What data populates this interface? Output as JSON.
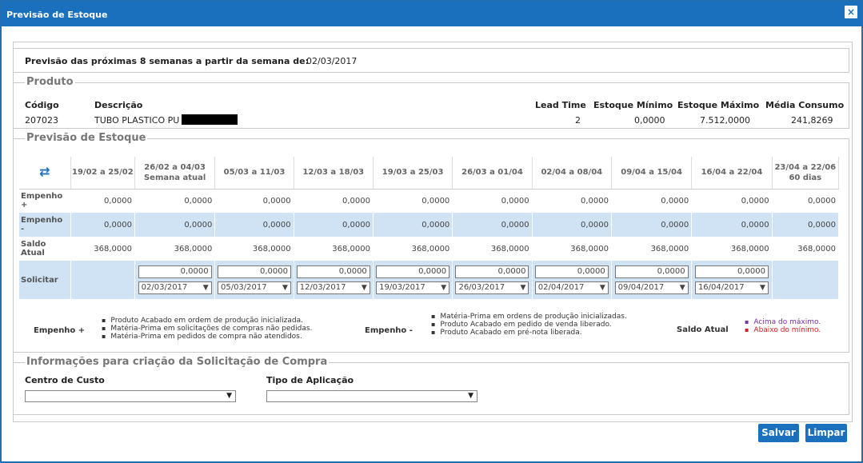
{
  "window": {
    "title": "Previsão de Estoque",
    "close_glyph": "×"
  },
  "week": {
    "label": "Previsão das próximas 8 semanas a partir da semana de:",
    "value": "02/03/2017"
  },
  "produto": {
    "legend": "Produto",
    "headers": {
      "codigo": "Código",
      "descricao": "Descrição",
      "lead_time": "Lead Time",
      "estoque_minimo": "Estoque Mínimo",
      "estoque_maximo": "Estoque Máximo",
      "media_consumo": "Média Consumo"
    },
    "values": {
      "codigo": "207023",
      "descricao": "TUBO PLASTICO PU C",
      "lead_time": "2",
      "estoque_minimo": "0,0000",
      "estoque_maximo": "7.512,0000",
      "media_consumo": "241,8269"
    }
  },
  "forecast": {
    "legend": "Previsão de Estoque",
    "refresh_icon": "refresh-icon",
    "columns": [
      {
        "range": "19/02 a 25/02",
        "sub": ""
      },
      {
        "range": "26/02 a 04/03",
        "sub": "Semana atual"
      },
      {
        "range": "05/03 a 11/03",
        "sub": ""
      },
      {
        "range": "12/03 a 18/03",
        "sub": ""
      },
      {
        "range": "19/03 a 25/03",
        "sub": ""
      },
      {
        "range": "26/03 a 01/04",
        "sub": ""
      },
      {
        "range": "02/04 a 08/04",
        "sub": ""
      },
      {
        "range": "09/04 a 15/04",
        "sub": ""
      },
      {
        "range": "16/04 a 22/04",
        "sub": ""
      },
      {
        "range": "23/04 a 22/06",
        "sub": "60 dias"
      }
    ],
    "rows": {
      "empenho_mais": {
        "label": "Empenho +",
        "values": [
          "0,0000",
          "0,0000",
          "0,0000",
          "0,0000",
          "0,0000",
          "0,0000",
          "0,0000",
          "0,0000",
          "0,0000",
          "0,0000"
        ]
      },
      "empenho_menos": {
        "label": "Empenho -",
        "values": [
          "0,0000",
          "0,0000",
          "0,0000",
          "0,0000",
          "0,0000",
          "0,0000",
          "0,0000",
          "0,0000",
          "0,0000",
          "0,0000"
        ]
      },
      "saldo_atual": {
        "label": "Saldo Atual",
        "values": [
          "368,0000",
          "368,0000",
          "368,0000",
          "368,0000",
          "368,0000",
          "368,0000",
          "368,0000",
          "368,0000",
          "368,0000",
          "368,0000"
        ]
      },
      "solicitar": {
        "label": "Solicitar",
        "quantities": [
          "0,0000",
          "0,0000",
          "0,0000",
          "0,0000",
          "0,0000",
          "0,0000",
          "0,0000",
          "0,0000"
        ],
        "dates": [
          "02/03/2017",
          "05/03/2017",
          "12/03/2017",
          "19/03/2017",
          "26/03/2017",
          "02/04/2017",
          "09/04/2017",
          "16/04/2017"
        ]
      }
    },
    "legend_notes": {
      "empenho_mais": {
        "title": "Empenho +",
        "items": [
          "Produto Acabado em ordem de produção inicializada.",
          "Matéria-Prima em solicitações de compras não pedidas.",
          "Matéria-Prima em pedidos de compra não atendidos."
        ]
      },
      "empenho_menos": {
        "title": "Empenho -",
        "items": [
          "Matéria-Prima em ordens de produção inicializadas.",
          "Produto Acabado em pedido de venda liberado.",
          "Produto Acabado em pré-nota liberada."
        ]
      },
      "saldo_atual": {
        "title": "Saldo Atual",
        "above": "Acima do máximo.",
        "below": "Abaixo do mínimo.",
        "above_color": "#7b2fa4",
        "below_color": "#d42020"
      }
    }
  },
  "solicitacao": {
    "legend": "Informações para criação da Solicitação de Compra",
    "centro_custo": {
      "label": "Centro de Custo",
      "value": ""
    },
    "tipo_aplicacao": {
      "label": "Tipo de Aplicação",
      "value": ""
    }
  },
  "buttons": {
    "salvar": "Salvar",
    "limpar": "Limpar"
  },
  "colors": {
    "accent": "#1a70bd",
    "band": "#cfe3f5"
  }
}
